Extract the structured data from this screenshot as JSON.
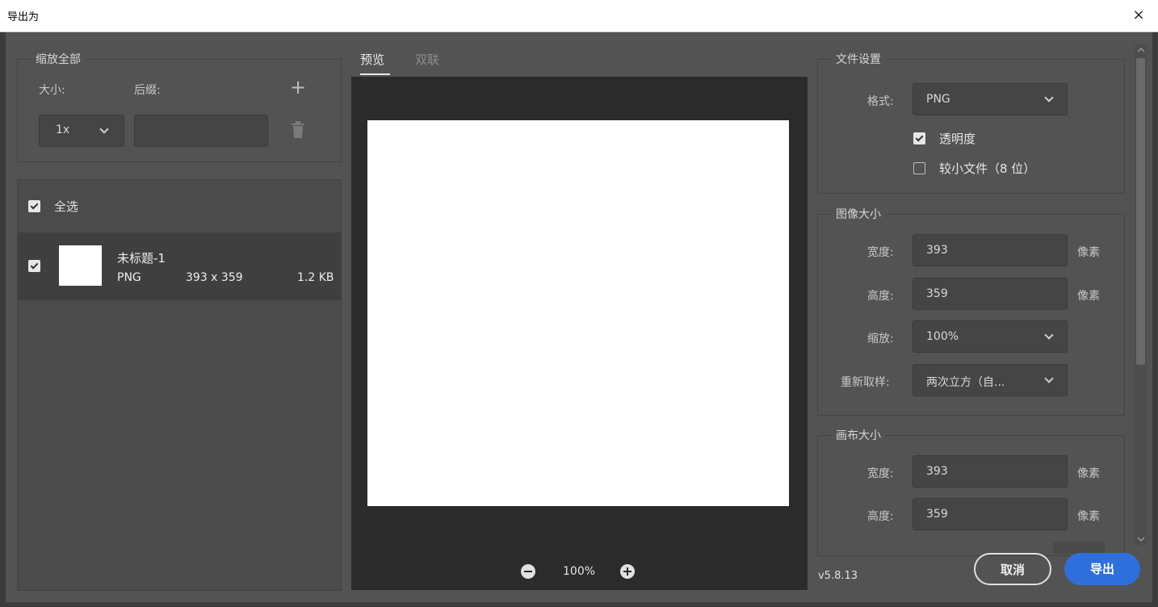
{
  "window": {
    "title": "导出为",
    "close": "×"
  },
  "scale_all": {
    "legend": "缩放全部",
    "size_label": "大小:",
    "suffix_label": "后缀:",
    "add": "+",
    "size_value": "1x",
    "suffix_value": ""
  },
  "assets": {
    "select_all": "全选",
    "items": [
      {
        "name": "未标题-1",
        "format": "PNG",
        "dimensions": "393 x 359",
        "filesize": "1.2 KB"
      }
    ]
  },
  "preview": {
    "tabs": [
      "预览",
      "双联"
    ],
    "zoom": "100%"
  },
  "file_settings": {
    "legend": "文件设置",
    "format_label": "格式:",
    "format_value": "PNG",
    "transparency": "透明度",
    "smaller_file": "较小文件（8 位）"
  },
  "image_size": {
    "legend": "图像大小",
    "width_label": "宽度:",
    "width_value": "393",
    "height_label": "高度:",
    "height_value": "359",
    "scale_label": "缩放:",
    "scale_value": "100%",
    "resample_label": "重新取样:",
    "resample_value": "两次立方（自...",
    "unit": "像素"
  },
  "canvas_size": {
    "legend": "画布大小",
    "width_label": "宽度:",
    "width_value": "393",
    "height_label": "高度:",
    "height_value": "359",
    "unit": "像素"
  },
  "footer": {
    "version": "v5.8.13",
    "cancel": "取消",
    "export": "导出"
  }
}
